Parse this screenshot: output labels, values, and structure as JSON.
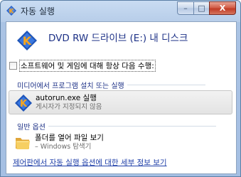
{
  "window": {
    "title": "자동 실행",
    "controls": {
      "minimize": "–",
      "maximize": "□",
      "close": "X"
    }
  },
  "drive": {
    "title": "DVD RW 드라이브 (E:) 내 디스크"
  },
  "always_option": {
    "label": "소프트웨어 및 게임에 대해 항상 다음 수행:",
    "checked": false
  },
  "sections": {
    "install": {
      "heading": "미디어에서 프로그램 설치 또는 실행",
      "option": {
        "main": "autorun.exe 실행",
        "sub": "게시자가 지정되지 않음",
        "icon": "program-k-icon"
      }
    },
    "general": {
      "heading": "일반 옵션",
      "option": {
        "main": "폴더를 열어 파일 보기",
        "sub": "– Windows 탐색기",
        "icon": "folder-icon"
      }
    }
  },
  "footer": {
    "link": "제어판에서 자동 실행 옵션에 대한 세부 정보 보기"
  },
  "colors": {
    "accent_text": "#1e3287",
    "link": "#1f3fa8",
    "close_button": "#c13b26"
  }
}
